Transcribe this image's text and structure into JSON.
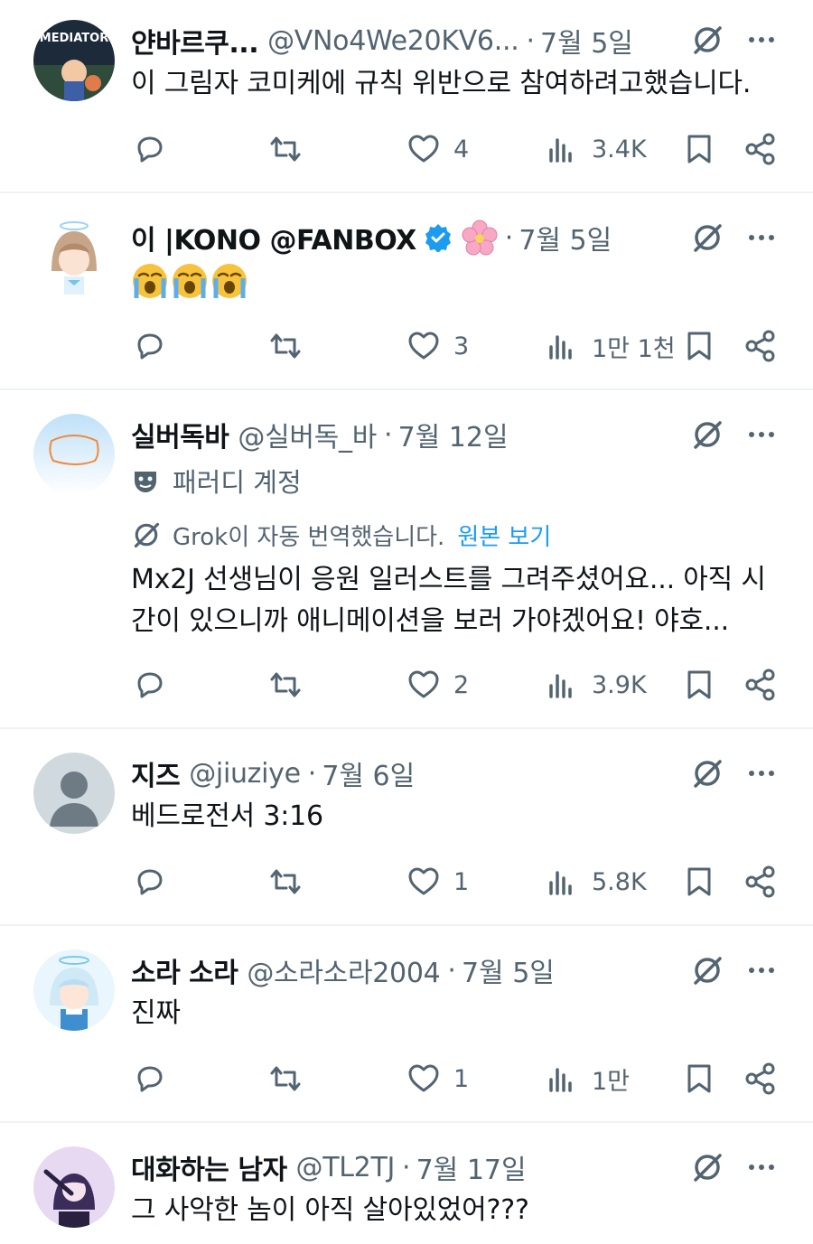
{
  "posts": [
    {
      "name": "얀바르쿠...",
      "handle": "@VNo4We20KV6...",
      "time": "7월 5일",
      "text": "이 그림자 코미케에 규칙 위반으로 참여하려고했습니다.",
      "likes": "4",
      "views": "3.4K"
    },
    {
      "name": "이 |KONO @FANBOX",
      "handle": "",
      "time": "7월 5일",
      "emoji": [
        "loudly-crying-face",
        "loudly-crying-face",
        "loudly-crying-face"
      ],
      "likes": "3",
      "views": "1만 1천"
    },
    {
      "name": "실버독바",
      "handle": "@실버독_바",
      "time": "7월 12일",
      "parody_label": "패러디 계정",
      "translated_note": "Grok이 자동 번역했습니다.",
      "see_original": "원본 보기",
      "text": "Mx2J 선생님이 응원 일러스트를 그려주셨어요... 아직 시간이 있으니까 애니메이션을 보러 가야겠어요! 야호...",
      "likes": "2",
      "views": "3.9K"
    },
    {
      "name": "지즈",
      "handle": "@jiuziye",
      "time": "7월 6일",
      "text": "베드로전서 3:16",
      "likes": "1",
      "views": "5.8K"
    },
    {
      "name": "소라 소라",
      "handle": "@소라소라2004",
      "time": "7월 5일",
      "text": "진짜",
      "likes": "1",
      "views": "1만"
    },
    {
      "name": "대화하는 남자",
      "handle": "@TL2TJ",
      "time": "7월 17일",
      "text": "그 사악한 놈이 아직 살아있었어???"
    }
  ],
  "separator": "·",
  "icons": {
    "reply": "reply-icon",
    "repost": "repost-icon",
    "like": "heart-icon",
    "views": "views-icon",
    "bookmark": "bookmark-icon",
    "share": "share-icon",
    "grok": "grok-icon",
    "more": "more-icon",
    "verified": "verified-badge-icon",
    "flower": "cherry-blossom-icon",
    "parody": "parody-mask-icon"
  },
  "colors": {
    "text": "#0f1419",
    "secondary": "#536471",
    "link": "#1d9bf0",
    "divider": "#eff3f4",
    "verified": "#1d9bf0"
  }
}
